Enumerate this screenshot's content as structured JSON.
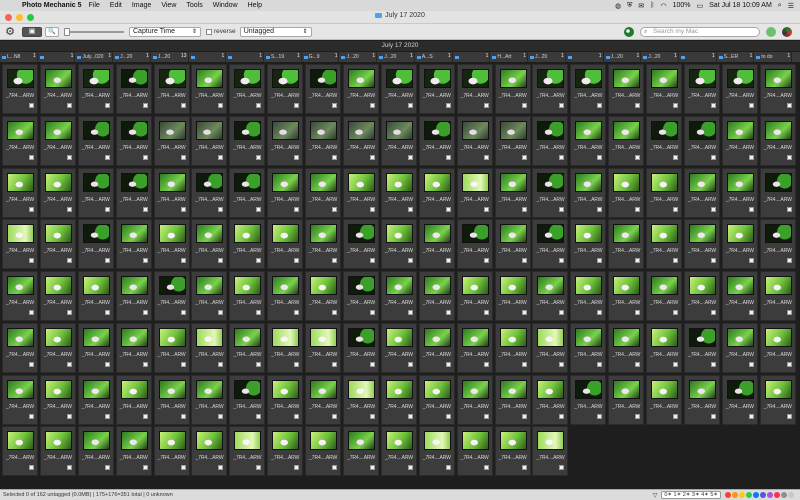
{
  "menubar": {
    "apple_glyph": "",
    "app_name": "Photo Mechanic 5",
    "menus": [
      "File",
      "Edit",
      "Image",
      "View",
      "Tools",
      "Window",
      "Help"
    ],
    "battery": "100%",
    "datetime": "Sat Jul 18  10:09 AM"
  },
  "window": {
    "title": "July 17 2020",
    "traffic_colors": [
      "#fd5f57",
      "#febc2e",
      "#28c840"
    ]
  },
  "toolbar": {
    "gear_glyph": "⚙",
    "view_glyph": "▣",
    "zoom_glyph": "🔍",
    "sort_value": "Capture Time",
    "reverse_label": "reverse",
    "filter_value": "Untagged",
    "search_placeholder": "Search my Mac"
  },
  "date_header": "July 17 2020",
  "folders": [
    {
      "name": "L...N8",
      "count": "1"
    },
    {
      "name": "",
      "count": "1"
    },
    {
      "name": "July...020",
      "count": "1"
    },
    {
      "name": "J...20",
      "count": "1"
    },
    {
      "name": "J...20",
      "count": "13"
    },
    {
      "name": "",
      "count": "1"
    },
    {
      "name": "",
      "count": "1"
    },
    {
      "name": "S...19",
      "count": "1"
    },
    {
      "name": "G...9",
      "count": "1"
    },
    {
      "name": "J...20",
      "count": "1"
    },
    {
      "name": "J...20",
      "count": "1"
    },
    {
      "name": "A...S",
      "count": "1"
    },
    {
      "name": "",
      "count": "1"
    },
    {
      "name": "H...Art",
      "count": "1"
    },
    {
      "name": "J...20",
      "count": "1"
    },
    {
      "name": "",
      "count": "1"
    },
    {
      "name": "J...20",
      "count": "1"
    },
    {
      "name": "J...20",
      "count": "1"
    },
    {
      "name": "",
      "count": "1"
    },
    {
      "name": "S...ER",
      "count": "1"
    },
    {
      "name": "to do",
      "count": "1"
    }
  ],
  "thumb_label": "_7R4....ARW",
  "thumb_count": 162,
  "thumb_pattern": [
    0,
    1,
    0,
    3,
    0,
    1,
    0,
    0,
    3,
    1,
    0,
    0,
    0,
    1,
    0,
    0,
    1,
    1,
    0,
    0,
    1,
    1,
    1,
    3,
    3,
    5,
    5,
    3,
    5,
    5,
    5,
    5,
    3,
    5,
    5,
    3,
    1,
    1,
    3,
    3,
    1,
    1,
    2,
    2,
    3,
    3,
    1,
    3,
    3,
    1,
    1,
    2,
    2,
    2,
    4,
    1,
    3,
    1,
    2,
    2,
    1,
    1,
    3,
    4,
    2,
    3,
    1,
    2,
    1,
    2,
    2,
    1,
    3,
    2,
    1,
    3,
    1,
    3,
    2,
    1,
    2,
    1,
    2,
    3,
    1,
    2,
    2,
    1,
    3,
    1,
    2,
    1,
    2,
    3,
    1,
    1,
    2,
    2,
    1,
    2,
    2,
    1,
    2,
    1,
    2,
    1,
    2,
    1,
    1,
    2,
    4,
    1,
    4,
    4,
    3,
    2,
    1,
    1,
    2,
    4,
    1,
    1,
    2,
    3,
    1,
    2,
    1,
    2,
    1,
    2,
    1,
    1,
    3,
    2,
    1,
    4,
    2,
    2,
    1,
    1,
    2,
    3,
    1,
    2,
    1,
    3,
    2,
    2,
    2,
    1,
    1,
    2,
    2,
    4,
    2,
    2,
    1,
    2,
    4,
    2,
    2,
    4
  ],
  "statusbar": {
    "text": "Selected 0 of 162 untagged (0.0MB) | 175+176=351 total | 0 unknown",
    "filter_glyph": "▽",
    "rating_text": "0✶ 1✶ 2✶ 3✶ 4✶ 5✶",
    "swatch_colors": [
      "#ff3b30",
      "#ff9500",
      "#ffcc00",
      "#34c759",
      "#007aff",
      "#5856d6",
      "#af52de",
      "#ff2d55",
      "#8e8e93",
      "#c7c7cc"
    ]
  }
}
